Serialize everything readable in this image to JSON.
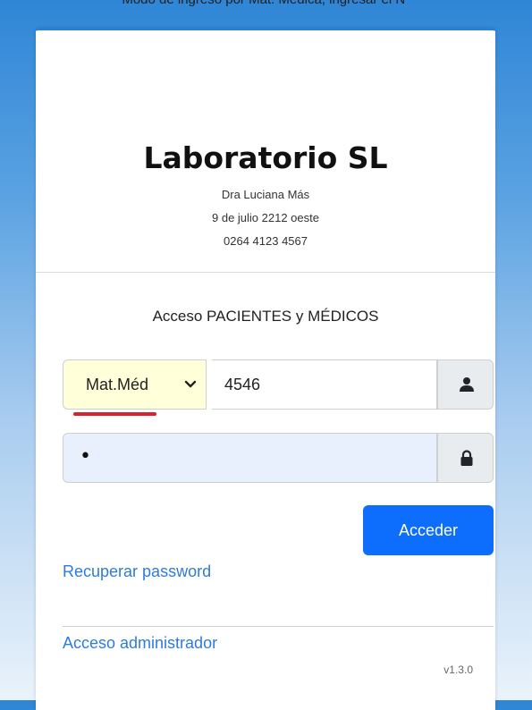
{
  "top_caption": "Modo de ingreso por Mat. Médica, ingresar el Nº",
  "header": {
    "title": "Laboratorio SL",
    "line1": "Dra Luciana Más",
    "line2": "9 de julio 2212 oeste",
    "line3": "0264 4123 4567"
  },
  "form": {
    "title": "Acceso PACIENTES y MÉDICOS",
    "id_type_selected": "Mat.Méd",
    "id_number": "4546",
    "password_masked": "•",
    "submit_label": "Acceder"
  },
  "links": {
    "recover": "Recuperar password",
    "admin": "Acceso administrador"
  },
  "version": "v1.3.0",
  "colors": {
    "primary": "#0d6efd",
    "link": "#2e7be0",
    "select_bg": "#ffffd9",
    "password_bg": "#e8f0fe",
    "underline": "#d9232b"
  },
  "icons": {
    "user": "user-icon",
    "lock": "lock-icon",
    "chevron": "chevron-down-icon"
  }
}
